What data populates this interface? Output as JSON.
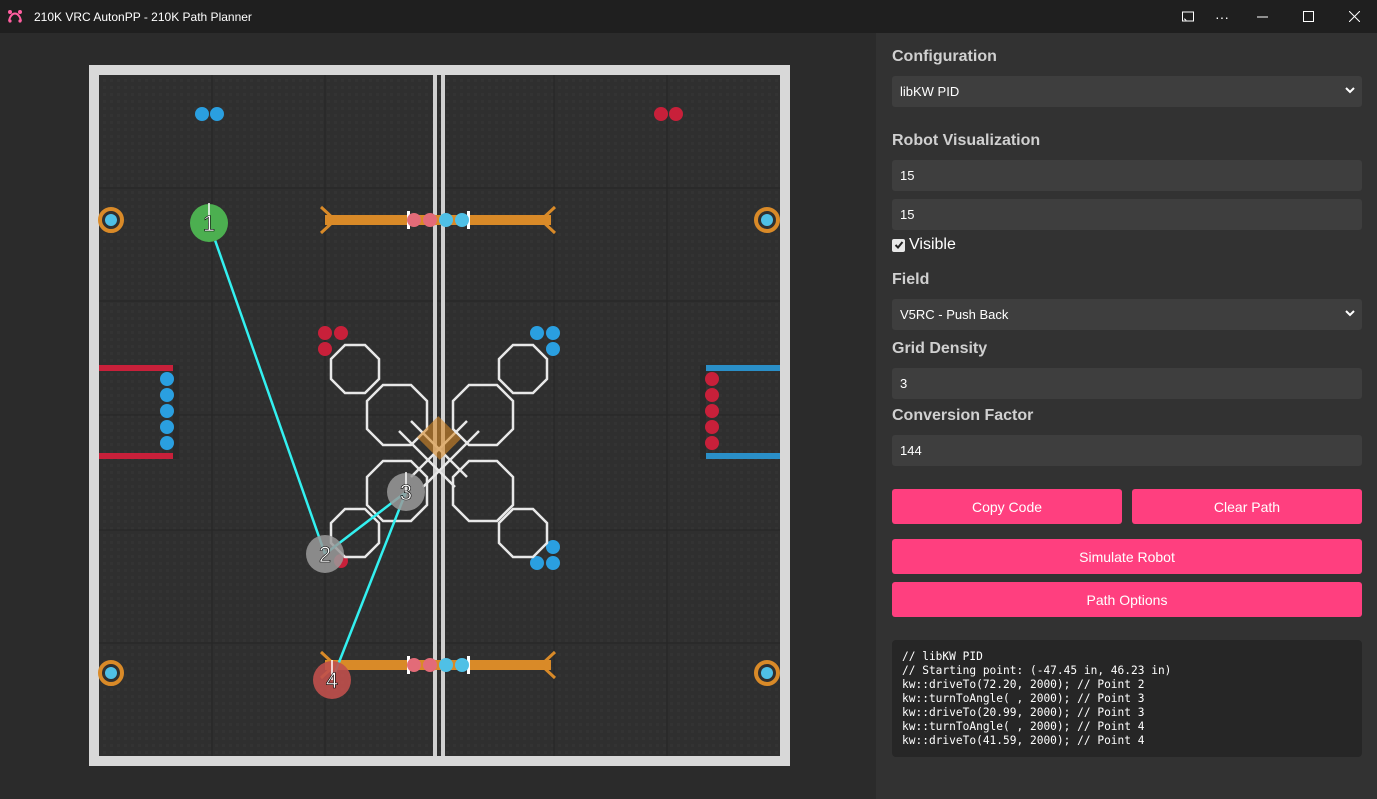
{
  "window": {
    "title": "210K VRC AutonPP - 210K Path Planner",
    "controls": [
      "cast-icon",
      "more-icon",
      "minimize-icon",
      "maximize-icon",
      "close-icon"
    ]
  },
  "colors": {
    "accent": "#ff3f7f",
    "path": "#33f0f0",
    "point_start": "#4caf50",
    "point_end": "#c0504d",
    "point_mid": "#9a9a9a"
  },
  "path_points": [
    {
      "label": "1"
    },
    {
      "label": "2"
    },
    {
      "label": "3"
    },
    {
      "label": "4"
    }
  ],
  "sidebar": {
    "configuration_label": "Configuration",
    "configuration_value": "libKW PID",
    "robot_vis_label": "Robot Visualization",
    "robot_width": "15",
    "robot_length": "15",
    "visible_label": "Visible",
    "field_label": "Field",
    "field_value": "V5RC - Push Back",
    "grid_density_label": "Grid Density",
    "grid_density": "3",
    "conversion_label": "Conversion Factor",
    "conversion": "144",
    "copy_code": "Copy Code",
    "clear_path": "Clear Path",
    "simulate": "Simulate Robot",
    "path_options": "Path Options"
  },
  "code_lines": [
    "// libKW PID",
    "// Starting point: (-47.45 in, 46.23 in)",
    "kw::driveTo(72.20, 2000); // Point 2",
    "kw::turnToAngle( , 2000); // Point 3",
    "kw::driveTo(20.99, 2000); // Point 3",
    "kw::turnToAngle( , 2000); // Point 4",
    "kw::driveTo(41.59, 2000); // Point 4"
  ]
}
